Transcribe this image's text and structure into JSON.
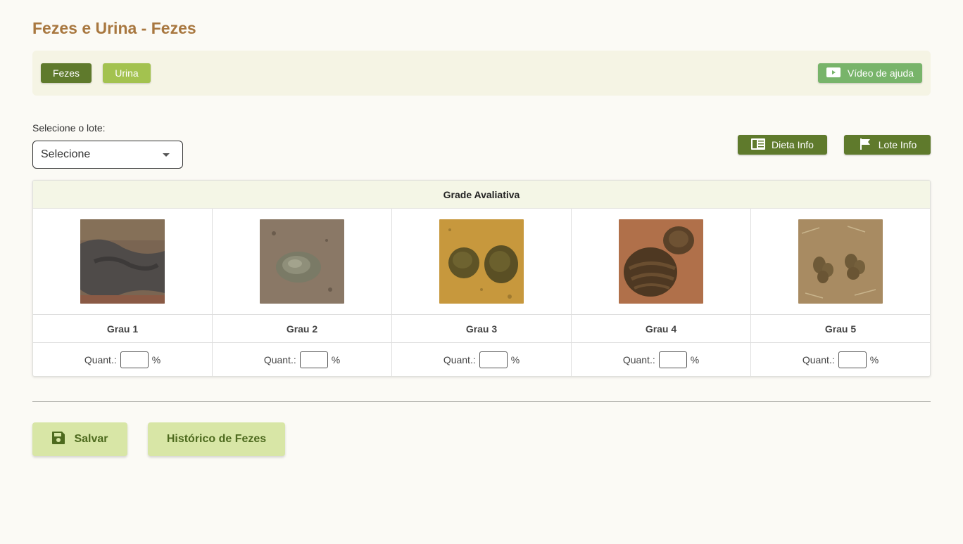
{
  "page": {
    "title": "Fezes e Urina - Fezes"
  },
  "tabs": [
    {
      "label": "Fezes",
      "active": true
    },
    {
      "label": "Urina",
      "active": false
    }
  ],
  "help_button": {
    "label": "Vídeo de ajuda",
    "icon": "video-icon"
  },
  "lote": {
    "label": "Selecione o lote:",
    "selected": "Selecione"
  },
  "info_buttons": {
    "dieta": {
      "label": "Dieta Info",
      "icon": "book-icon"
    },
    "lote": {
      "label": "Lote Info",
      "icon": "flag-icon"
    }
  },
  "grade": {
    "title": "Grade Avaliativa",
    "quant_label": "Quant.:",
    "unit": "%",
    "items": [
      {
        "label": "Grau 1",
        "image": "loose-dark-feces-photo"
      },
      {
        "label": "Grau 2",
        "image": "soft-grey-feces-photo"
      },
      {
        "label": "Grau 3",
        "image": "two-pat-feces-photo"
      },
      {
        "label": "Grau 4",
        "image": "stacked-feces-photo"
      },
      {
        "label": "Grau 5",
        "image": "dry-pellet-feces-photo"
      }
    ]
  },
  "actions": {
    "save": {
      "label": "Salvar",
      "icon": "floppy-disk-icon"
    },
    "history": {
      "label": "Histórico de Fezes"
    }
  },
  "colors": {
    "title": "#a8773f",
    "active_tab": "#5f7a2c",
    "inactive_tab": "#a3c24f",
    "help": "#78b46a",
    "action_bg": "#d8e6a6"
  }
}
